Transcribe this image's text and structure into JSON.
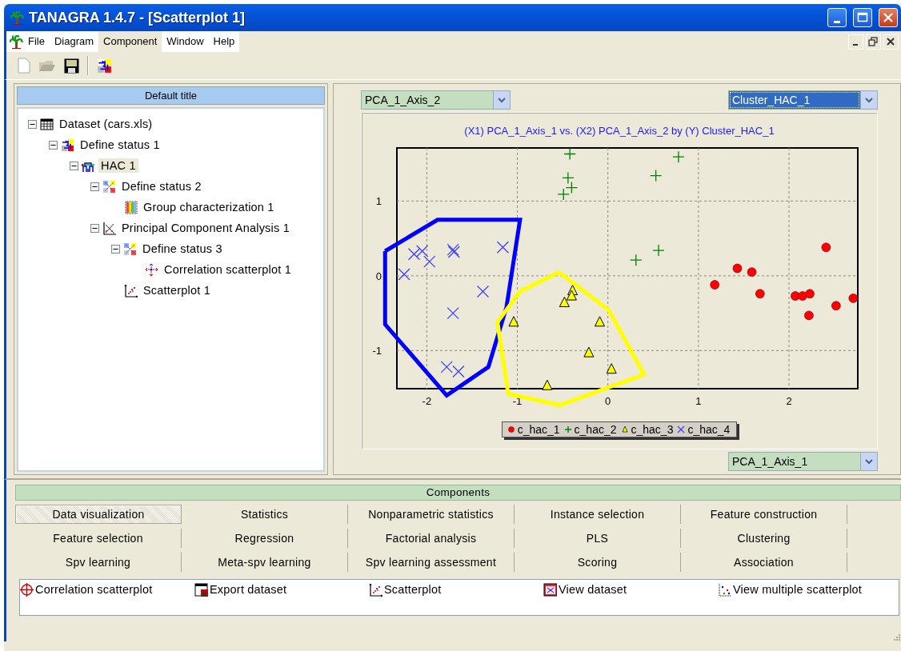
{
  "window": {
    "title": "TANAGRA 1.4.7 - [Scatterplot 1]"
  },
  "menu": [
    {
      "label": "File",
      "selected": false
    },
    {
      "label": "Diagram",
      "selected": false
    },
    {
      "label": "Component",
      "selected": true
    },
    {
      "label": "Window",
      "selected": false
    },
    {
      "label": "Help",
      "selected": false
    }
  ],
  "tree": {
    "title": "Default title",
    "nodes": [
      {
        "label": "Dataset (cars.xls)",
        "kind": "dataset",
        "expanded": true,
        "selected": false,
        "children": [
          {
            "label": "Define status 1",
            "kind": "status",
            "expanded": true,
            "selected": false,
            "children": [
              {
                "label": "HAC 1",
                "kind": "hac",
                "expanded": true,
                "selected": true,
                "children": [
                  {
                    "label": "Define status 2",
                    "kind": "status2",
                    "expanded": true,
                    "selected": false,
                    "children": [
                      {
                        "label": "Group characterization 1",
                        "kind": "groups",
                        "selected": false
                      }
                    ]
                  },
                  {
                    "label": "Principal Component Analysis 1",
                    "kind": "pca",
                    "expanded": true,
                    "selected": false,
                    "children": [
                      {
                        "label": "Define status 3",
                        "kind": "status2",
                        "expanded": true,
                        "selected": false,
                        "children": [
                          {
                            "label": "Correlation scatterplot 1",
                            "kind": "correlation",
                            "selected": false
                          }
                        ]
                      },
                      {
                        "label": "Scatterplot 1",
                        "kind": "scatter",
                        "selected": false
                      }
                    ]
                  }
                ]
              }
            ]
          }
        ]
      }
    ]
  },
  "plot": {
    "y_axis_select": {
      "value": "PCA_1_Axis_2",
      "focused": false
    },
    "class_select": {
      "value": "Cluster_HAC_1",
      "focused": true
    },
    "x_axis_select": {
      "value": "PCA_1_Axis_1",
      "focused": false
    },
    "chart_data": {
      "type": "scatter",
      "title": "(X1) PCA_1_Axis_1 vs. (X2) PCA_1_Axis_2 by (Y) Cluster_HAC_1",
      "grid": true,
      "xlim": [
        -2.33,
        2.76
      ],
      "ylim": [
        -1.51,
        1.71
      ],
      "xticks": [
        {
          "value": -2,
          "label": "-2"
        },
        {
          "value": -1,
          "label": "-1"
        },
        {
          "value": 0,
          "label": "0"
        },
        {
          "value": 1,
          "label": "1"
        },
        {
          "value": 2,
          "label": "2"
        }
      ],
      "yticks": [
        {
          "value": -1,
          "label": "-1"
        },
        {
          "value": 0,
          "label": "0"
        },
        {
          "value": 1,
          "label": "1"
        }
      ],
      "series": [
        {
          "name": "c_hac_1",
          "color": "#ff0000",
          "x": [
            1.18,
            1.43,
            1.59,
            1.68,
            2.07,
            2.15,
            2.23,
            2.22,
            2.41,
            2.52,
            2.71
          ],
          "values": [
            -0.12,
            0.1,
            0.05,
            -0.24,
            -0.27,
            -0.27,
            -0.24,
            -0.53,
            0.38,
            -0.4,
            -0.3
          ]
        },
        {
          "name": "c_hac_2",
          "color": "#008000",
          "x": [
            -0.42,
            -0.44,
            -0.4,
            -0.49,
            0.78,
            0.53,
            0.31,
            0.56
          ],
          "values": [
            1.63,
            1.31,
            1.18,
            1.09,
            1.59,
            1.34,
            0.21,
            0.34
          ]
        },
        {
          "name": "c_hac_3",
          "color": "#ffff00",
          "x": [
            -1.04,
            -0.39,
            -0.4,
            -0.48,
            -0.09,
            -0.21,
            0.04,
            -0.67
          ],
          "values": [
            -0.62,
            -0.2,
            -0.27,
            -0.36,
            -0.62,
            -1.03,
            -1.25,
            -1.47
          ]
        },
        {
          "name": "c_hac_4",
          "color": "#4040ff",
          "x": [
            -2.25,
            -2.14,
            -2.05,
            -1.97,
            -1.71,
            -1.7,
            -1.16,
            -1.38,
            -1.71,
            -1.78,
            -1.65
          ],
          "values": [
            0.02,
            0.29,
            0.33,
            0.19,
            0.35,
            0.32,
            0.38,
            -0.21,
            -0.5,
            -1.22,
            -1.28
          ]
        }
      ]
    }
  },
  "components": {
    "title": "Components",
    "tabs": [
      {
        "label": "Data visualization",
        "selected": true
      },
      {
        "label": "Statistics",
        "selected": false
      },
      {
        "label": "Nonparametric statistics",
        "selected": false
      },
      {
        "label": "Instance selection",
        "selected": false
      },
      {
        "label": "Feature construction",
        "selected": false
      },
      {
        "label": "Feature selection",
        "selected": false
      },
      {
        "label": "Regression",
        "selected": false
      },
      {
        "label": "Factorial analysis",
        "selected": false
      },
      {
        "label": "PLS",
        "selected": false
      },
      {
        "label": "Clustering",
        "selected": false
      },
      {
        "label": "Spv learning",
        "selected": false
      },
      {
        "label": "Meta-spv learning",
        "selected": false
      },
      {
        "label": "Spv learning assessment",
        "selected": false
      },
      {
        "label": "Scoring",
        "selected": false
      },
      {
        "label": "Association",
        "selected": false
      }
    ],
    "items": [
      {
        "label": "Correlation scatterplot",
        "kind": "correlation"
      },
      {
        "label": "Export dataset",
        "kind": "export"
      },
      {
        "label": "Scatterplot",
        "kind": "scatter"
      },
      {
        "label": "View dataset",
        "kind": "view"
      },
      {
        "label": "View multiple scatterplot",
        "kind": "multi"
      }
    ]
  }
}
